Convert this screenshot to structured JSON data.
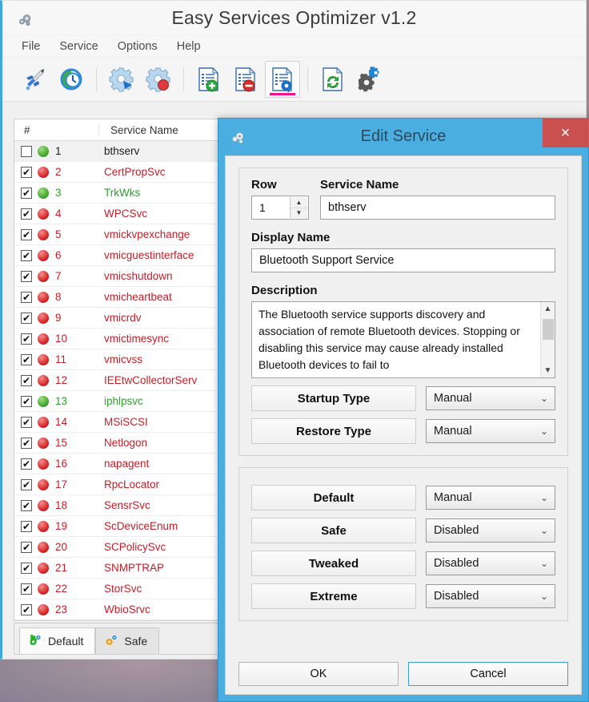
{
  "app": {
    "title": "Easy Services Optimizer v1.2",
    "icon": "gears-icon"
  },
  "menu": [
    {
      "label": "File"
    },
    {
      "label": "Service"
    },
    {
      "label": "Options"
    },
    {
      "label": "Help"
    }
  ],
  "toolbar": [
    {
      "name": "launch-optimizer-button",
      "icon": "rocket-icon",
      "active": false
    },
    {
      "name": "restore-point-button",
      "icon": "clock-restore-icon",
      "active": false
    },
    {
      "name": "start-service-button",
      "icon": "gear-play-icon",
      "active": false
    },
    {
      "name": "stop-service-button",
      "icon": "gear-stop-icon",
      "active": false
    },
    {
      "name": "add-service-button",
      "icon": "list-add-icon",
      "active": false
    },
    {
      "name": "remove-service-button",
      "icon": "list-remove-icon",
      "active": false
    },
    {
      "name": "edit-service-button",
      "icon": "list-edit-icon",
      "active": true
    },
    {
      "name": "refresh-button",
      "icon": "refresh-icon",
      "active": false
    },
    {
      "name": "settings-button",
      "icon": "gears-settings-icon",
      "active": false
    }
  ],
  "list": {
    "columns": {
      "num": "#",
      "name": "Service Name"
    },
    "rows": [
      {
        "n": "1",
        "name": "bthserv",
        "checked": false,
        "status": "green",
        "color": "black"
      },
      {
        "n": "2",
        "name": "CertPropSvc",
        "checked": true,
        "status": "red",
        "color": "red"
      },
      {
        "n": "3",
        "name": "TrkWks",
        "checked": true,
        "status": "green",
        "color": "green"
      },
      {
        "n": "4",
        "name": "WPCSvc",
        "checked": true,
        "status": "red",
        "color": "red"
      },
      {
        "n": "5",
        "name": "vmickvpexchange",
        "checked": true,
        "status": "red",
        "color": "red"
      },
      {
        "n": "6",
        "name": "vmicguestinterface",
        "checked": true,
        "status": "red",
        "color": "red"
      },
      {
        "n": "7",
        "name": "vmicshutdown",
        "checked": true,
        "status": "red",
        "color": "red"
      },
      {
        "n": "8",
        "name": "vmicheartbeat",
        "checked": true,
        "status": "red",
        "color": "red"
      },
      {
        "n": "9",
        "name": "vmicrdv",
        "checked": true,
        "status": "red",
        "color": "red"
      },
      {
        "n": "10",
        "name": "vmictimesync",
        "checked": true,
        "status": "red",
        "color": "red"
      },
      {
        "n": "11",
        "name": "vmicvss",
        "checked": true,
        "status": "red",
        "color": "red"
      },
      {
        "n": "12",
        "name": "IEEtwCollectorServ",
        "checked": true,
        "status": "red",
        "color": "red"
      },
      {
        "n": "13",
        "name": "iphlpsvc",
        "checked": true,
        "status": "green",
        "color": "green"
      },
      {
        "n": "14",
        "name": "MSiSCSI",
        "checked": true,
        "status": "red",
        "color": "red"
      },
      {
        "n": "15",
        "name": "Netlogon",
        "checked": true,
        "status": "red",
        "color": "red"
      },
      {
        "n": "16",
        "name": "napagent",
        "checked": true,
        "status": "red",
        "color": "red"
      },
      {
        "n": "17",
        "name": "RpcLocator",
        "checked": true,
        "status": "red",
        "color": "red"
      },
      {
        "n": "18",
        "name": "SensrSvc",
        "checked": true,
        "status": "red",
        "color": "red"
      },
      {
        "n": "19",
        "name": "ScDeviceEnum",
        "checked": true,
        "status": "red",
        "color": "red"
      },
      {
        "n": "20",
        "name": "SCPolicySvc",
        "checked": true,
        "status": "red",
        "color": "red"
      },
      {
        "n": "21",
        "name": "SNMPTRAP",
        "checked": true,
        "status": "red",
        "color": "red"
      },
      {
        "n": "22",
        "name": "StorSvc",
        "checked": true,
        "status": "red",
        "color": "red"
      },
      {
        "n": "23",
        "name": "WbioSrvc",
        "checked": true,
        "status": "red",
        "color": "red"
      }
    ]
  },
  "profile_tabs": [
    {
      "label": "Default",
      "icon": "gear-green-icon",
      "active": true
    },
    {
      "label": "Safe",
      "icon": "gear-orange-icon",
      "active": false
    }
  ],
  "dialog": {
    "title": "Edit Service",
    "icon": "gears-icon",
    "close_label": "×",
    "row_label": "Row",
    "row_value": "1",
    "service_name_label": "Service Name",
    "service_name_value": "bthserv",
    "display_name_label": "Display Name",
    "display_name_value": "Bluetooth Support Service",
    "description_label": "Description",
    "description_value": "The Bluetooth service supports discovery and association of remote Bluetooth devices. Stopping or disabling this service may cause already installed Bluetooth devices to fail to",
    "type_rows": [
      {
        "label": "Startup Type",
        "value": "Manual"
      },
      {
        "label": "Restore Type",
        "value": "Manual"
      }
    ],
    "profile_rows": [
      {
        "label": "Default",
        "value": "Manual"
      },
      {
        "label": "Safe",
        "value": "Disabled"
      },
      {
        "label": "Tweaked",
        "value": "Disabled"
      },
      {
        "label": "Extreme",
        "value": "Disabled"
      }
    ],
    "ok_label": "OK",
    "cancel_label": "Cancel"
  },
  "colors": {
    "accent_blue": "#4aafe0",
    "close_red": "#c9504f",
    "active_underline": "#f5108c",
    "running_green": "#3fa32c",
    "stopped_red": "#d32020"
  }
}
